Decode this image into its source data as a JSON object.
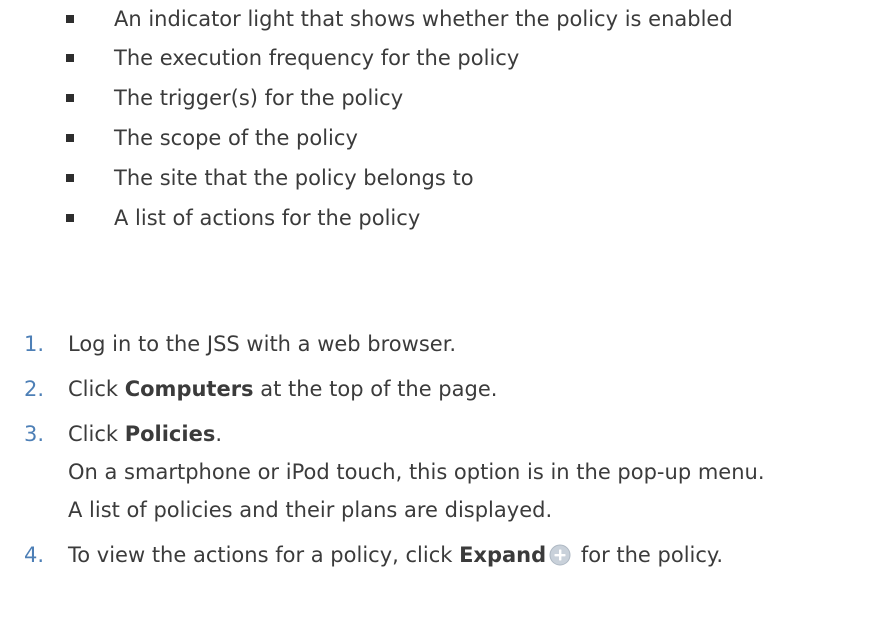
{
  "bullets": [
    "An indicator light that shows whether the policy is enabled",
    "The execution frequency for the policy",
    "The trigger(s) for the policy",
    "The scope of the policy",
    "The site that the policy belongs to",
    "A list of actions for the policy"
  ],
  "steps": [
    {
      "number": "1.",
      "text": "Log in to the JSS with a web browser."
    },
    {
      "number": "2.",
      "prefix": "Click ",
      "bold": "Computers",
      "suffix": " at the top of the page."
    },
    {
      "number": "3.",
      "prefix": "Click ",
      "bold": "Policies",
      "suffix": ".",
      "notes": [
        "On a smartphone or iPod touch, this option is in the pop-up menu.",
        "A list of policies and their plans are displayed."
      ]
    },
    {
      "number": "4.",
      "prefix": "To view the actions for a policy, click ",
      "bold": "Expand",
      "icon": "expand-plus-icon",
      "suffix": " for the policy."
    }
  ],
  "colors": {
    "text": "#3b3b3b",
    "step_number": "#4d7fb6",
    "icon_fill": "#c9d1da"
  }
}
